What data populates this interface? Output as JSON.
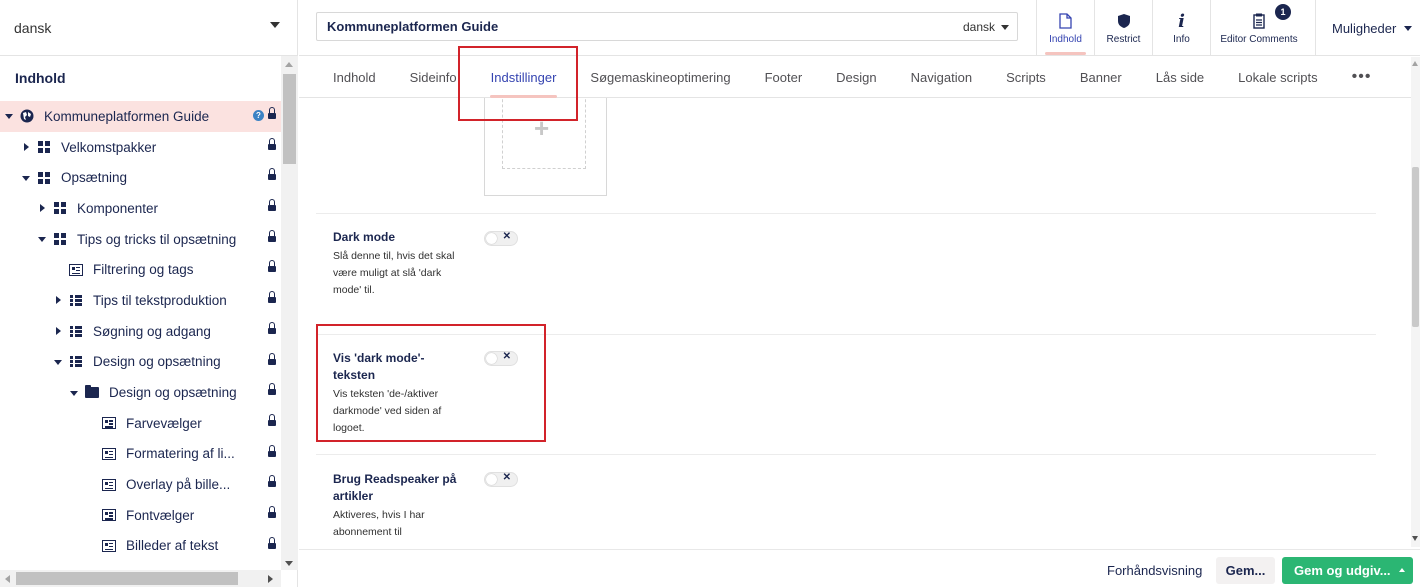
{
  "sidebar": {
    "language": "dansk",
    "tree_title": "Indhold",
    "items": [
      {
        "label": "Kommuneplatformen Guide"
      },
      {
        "label": "Velkomstpakker"
      },
      {
        "label": "Opsætning"
      },
      {
        "label": "Komponenter"
      },
      {
        "label": "Tips og tricks til opsætning"
      },
      {
        "label": "Filtrering og tags"
      },
      {
        "label": "Tips til tekstproduktion"
      },
      {
        "label": "Søgning og adgang"
      },
      {
        "label": "Design og opsætning"
      },
      {
        "label": "Design og opsætning"
      },
      {
        "label": "Farvevælger"
      },
      {
        "label": "Formatering af li..."
      },
      {
        "label": "Overlay på bille..."
      },
      {
        "label": "Fontvælger"
      },
      {
        "label": "Billeder af tekst"
      }
    ]
  },
  "header": {
    "page_name": "Kommuneplatformen Guide",
    "page_language": "dansk",
    "apps": [
      {
        "label": "Indhold",
        "icon": "document-icon"
      },
      {
        "label": "Restrict",
        "icon": "shield-icon"
      },
      {
        "label": "Info",
        "icon": "info-icon"
      },
      {
        "label": "Editor Comments",
        "icon": "notepad-icon",
        "badge": "1"
      }
    ],
    "options_label": "Muligheder"
  },
  "tabs": [
    "Indhold",
    "Sideinfo",
    "Indstillinger",
    "Søgemaskineoptimering",
    "Footer",
    "Design",
    "Navigation",
    "Scripts",
    "Banner",
    "Lås side",
    "Lokale scripts",
    "•••"
  ],
  "active_tab": "Indstillinger",
  "properties": [
    {
      "label": "Dark mode",
      "description": "Slå denne til, hvis det skal være muligt at slå 'dark mode' til.",
      "value": false
    },
    {
      "label": "Vis 'dark mode'-teksten",
      "description": "Vis teksten 'de-/aktiver darkmode' ved siden af logoet.",
      "value": false
    },
    {
      "label": "Brug Readspeaker på artikler",
      "description": "Aktiveres, hvis I har abonnement til",
      "value": false
    }
  ],
  "footer": {
    "preview": "Forhåndsvisning",
    "save": "Gem...",
    "publish": "Gem og udgiv..."
  },
  "colors": {
    "accent": "#3544b1",
    "text": "#1b264f",
    "highlight": "#d2232a",
    "publish": "#2bb673",
    "active_row": "#fbe2e0"
  }
}
